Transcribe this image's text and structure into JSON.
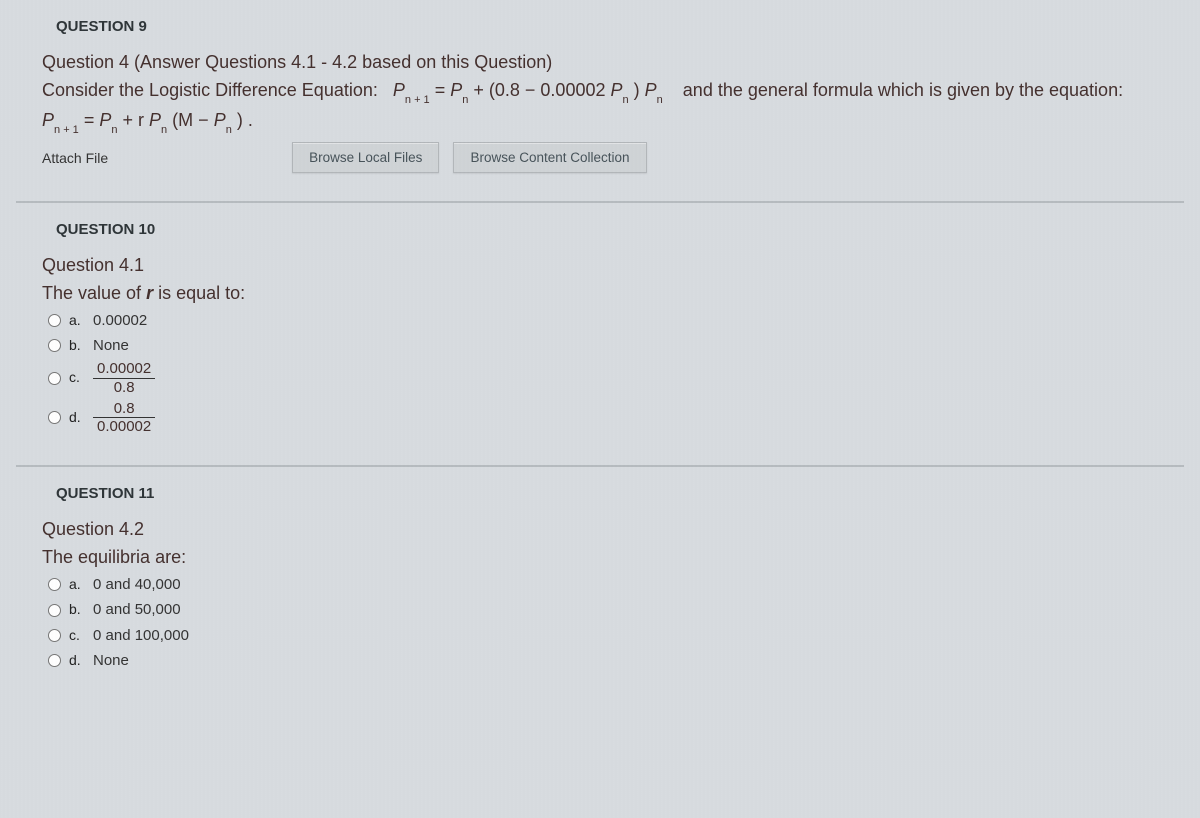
{
  "q9": {
    "title": "QUESTION 9",
    "heading": "Question 4 (Answer Questions 4.1 - 4.2 based on this Question)",
    "intro_a": "Consider the Logistic Difference Equation:",
    "intro_b": "and the general formula which is given by the equation:",
    "attach_label": "Attach File",
    "btn_local": "Browse Local Files",
    "btn_content": "Browse Content Collection",
    "eq1": {
      "P": "P",
      "n1": "n + 1",
      "eq": " = ",
      "Pn": "P",
      "n": "n",
      "plus": " + (0.8 − 0.00002 ",
      "Pb": "P",
      "nb": "n",
      "close": ") ",
      "Pc": "P",
      "nc": "n"
    },
    "eq2": {
      "P": "P",
      "n1": "n + 1",
      "eq": " = ",
      "Pn": "P",
      "n": "n",
      "plus": " + r",
      "Pb": "P",
      "nb": "n",
      "open": "(M − ",
      "Pc": "P",
      "nc": "n",
      "close": ") ."
    }
  },
  "q10": {
    "title": "QUESTION 10",
    "heading": "Question 4.1",
    "prompt_a": "The value of ",
    "prompt_r": "r",
    "prompt_b": " is equal to:",
    "options": {
      "a": {
        "letter": "a.",
        "text": "0.00002"
      },
      "b": {
        "letter": "b.",
        "text": "None"
      },
      "c": {
        "letter": "c.",
        "num": "0.00002",
        "den": "0.8"
      },
      "d": {
        "letter": "d.",
        "num": "0.8",
        "den": "0.00002"
      }
    }
  },
  "q11": {
    "title": "QUESTION 11",
    "heading": "Question 4.2",
    "prompt": "The equilibria are:",
    "options": {
      "a": {
        "letter": "a.",
        "text": "0 and 40,000"
      },
      "b": {
        "letter": "b.",
        "text": "0 and 50,000"
      },
      "c": {
        "letter": "c.",
        "text": "0 and 100,000"
      },
      "d": {
        "letter": "d.",
        "text": "None"
      }
    }
  }
}
